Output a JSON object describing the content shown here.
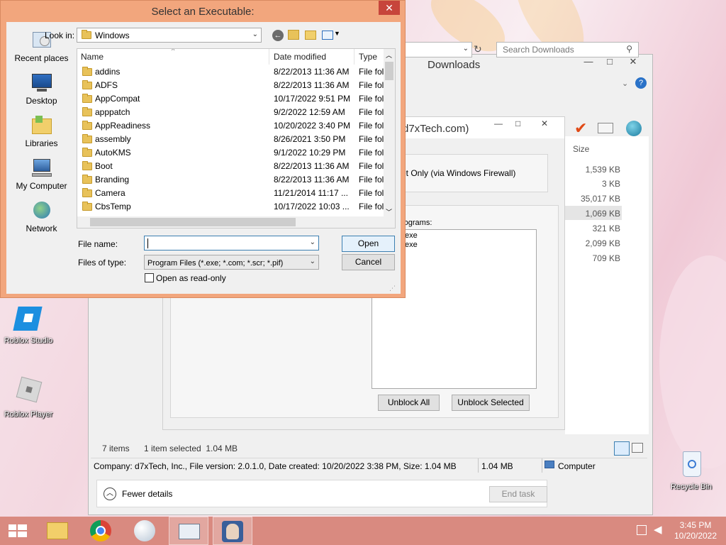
{
  "desktop": {
    "icons": [
      {
        "label": "Roblox Studio"
      },
      {
        "label": "Roblox Player"
      },
      {
        "label": "Recycle Bin"
      }
    ]
  },
  "explorer": {
    "title": "Downloads",
    "search_placeholder": "Search Downloads",
    "size_header": "Size",
    "sizes": [
      "1,539 KB",
      "3 KB",
      "35,017 KB",
      "1,069 KB",
      "321 KB",
      "2,099 KB",
      "709 KB"
    ],
    "items_count": "7 items",
    "selection": "1 item selected  1.04 MB",
    "detail_status": "Company: d7xTech, Inc., File version: 2.0.1.0, Date created: 10/20/2022 3:38 PM, Size: 1.04 MB",
    "detail_size": "1.04 MB",
    "detail_location": "Computer",
    "fewer_details": "Fewer details",
    "end_task": "End task"
  },
  "inner_dialog": {
    "title_fragment": "d7xTech.com)",
    "firewall_text": "et Only (via Windows Firewall)",
    "programs_label": "rograms:",
    "programs": [
      "exe",
      "exe"
    ],
    "unblock_all": "Unblock All",
    "unblock_selected": "Unblock Selected"
  },
  "open_dialog": {
    "title": "Select an Executable:",
    "look_in_label": "Look in:",
    "look_in_value": "Windows",
    "places": [
      {
        "label": "Recent places",
        "icon": "recent-places-icon"
      },
      {
        "label": "Desktop",
        "icon": "desktop-icon"
      },
      {
        "label": "Libraries",
        "icon": "libraries-icon"
      },
      {
        "label": "My Computer",
        "icon": "computer-icon"
      },
      {
        "label": "Network",
        "icon": "network-icon"
      }
    ],
    "columns": {
      "name": "Name",
      "date": "Date modified",
      "type": "Type"
    },
    "files": [
      {
        "name": "addins",
        "date": "8/22/2013 11:36 AM",
        "type": "File fol"
      },
      {
        "name": "ADFS",
        "date": "8/22/2013 11:36 AM",
        "type": "File fol"
      },
      {
        "name": "AppCompat",
        "date": "10/17/2022 9:51 PM",
        "type": "File fol"
      },
      {
        "name": "apppatch",
        "date": "9/2/2022 12:59 AM",
        "type": "File fol"
      },
      {
        "name": "AppReadiness",
        "date": "10/20/2022 3:40 PM",
        "type": "File fol"
      },
      {
        "name": "assembly",
        "date": "8/26/2021 3:50 PM",
        "type": "File fol"
      },
      {
        "name": "AutoKMS",
        "date": "9/1/2022 10:29 PM",
        "type": "File fol"
      },
      {
        "name": "Boot",
        "date": "8/22/2013 11:36 AM",
        "type": "File fol"
      },
      {
        "name": "Branding",
        "date": "8/22/2013 11:36 AM",
        "type": "File fol"
      },
      {
        "name": "Camera",
        "date": "11/21/2014 11:17 ...",
        "type": "File fol"
      },
      {
        "name": "CbsTemp",
        "date": "10/17/2022 10:03 ...",
        "type": "File fol"
      }
    ],
    "file_name_label": "File name:",
    "file_name_value": "",
    "files_of_type_label": "Files of type:",
    "files_of_type_value": "Program Files (*.exe; *.com; *.scr; *.pif)",
    "read_only_label": "Open as read-only",
    "open_button": "Open",
    "cancel_button": "Cancel",
    "close_symbol": "✕"
  },
  "taskbar": {
    "time": "3:45 PM",
    "date": "10/20/2022"
  },
  "colors": {
    "dialog_frame": "#f2a67d",
    "taskbar": "#d98a80",
    "close_red": "#c7453b",
    "accent_blue": "#3c7fb1"
  }
}
